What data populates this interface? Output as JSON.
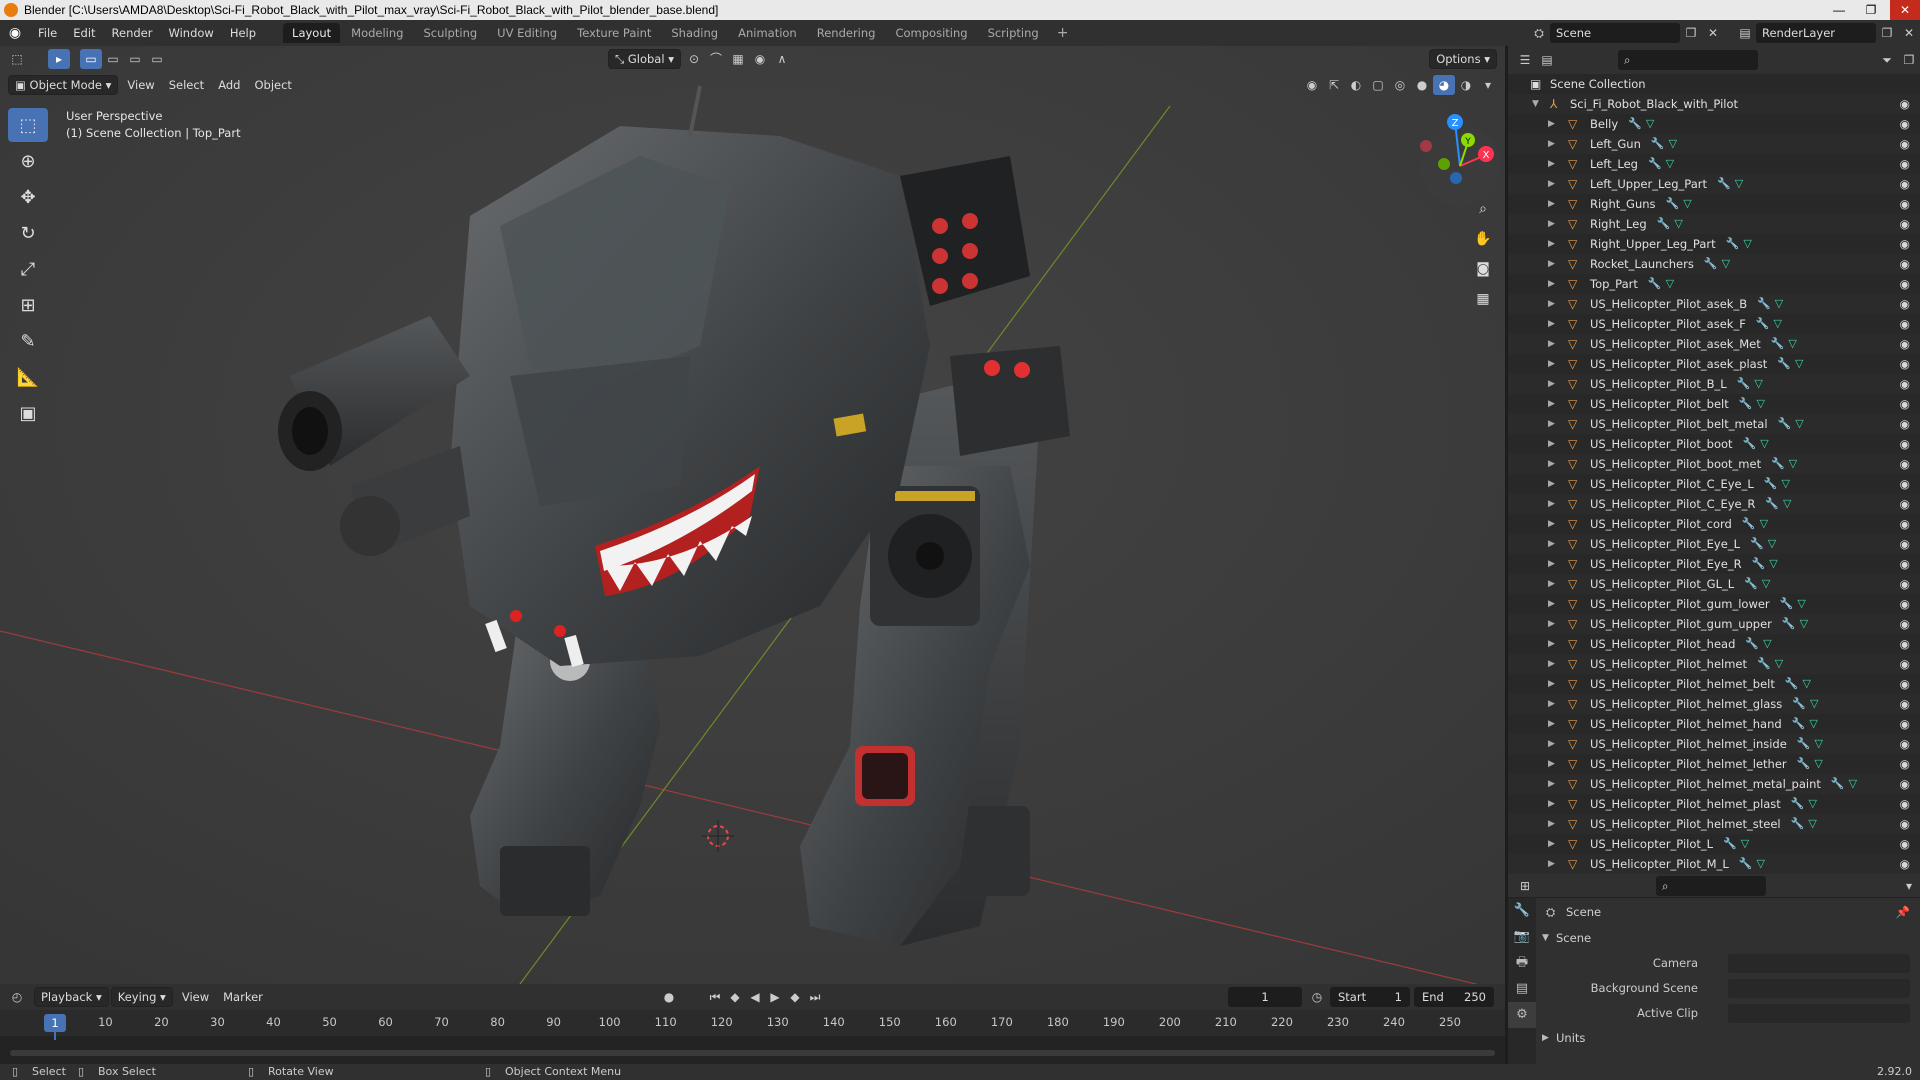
{
  "window": {
    "title": "Blender [C:\\Users\\AMDA8\\Desktop\\Sci-Fi_Robot_Black_with_Pilot_max_vray\\Sci-Fi_Robot_Black_with_Pilot_blender_base.blend]",
    "controls": [
      "—",
      "❐",
      "✕"
    ]
  },
  "menu": [
    "File",
    "Edit",
    "Render",
    "Window",
    "Help"
  ],
  "workspaces": [
    "Layout",
    "Modeling",
    "Sculpting",
    "UV Editing",
    "Texture Paint",
    "Shading",
    "Animation",
    "Rendering",
    "Compositing",
    "Scripting"
  ],
  "workspace_add": "+",
  "scene_name": "Scene",
  "render_layer": "RenderLayer",
  "viewport": {
    "mode": "Object Mode",
    "menus": [
      "View",
      "Select",
      "Add",
      "Object"
    ],
    "transform": "Global",
    "options": "Options",
    "info_line1": "User Perspective",
    "info_line2": "(1) Scene Collection | Top_Part",
    "gizmo": {
      "z": "Z",
      "y": "Y",
      "x": "X"
    },
    "colors": {
      "x_axis": "#ff3352",
      "y_axis": "#8bdc00",
      "z_axis": "#2890ff",
      "bg": "#393939"
    }
  },
  "outliner": {
    "root": "Scene Collection",
    "collection": "Sci_Fi_Robot_Black_with_Pilot",
    "items": [
      "Belly",
      "Left_Gun",
      "Left_Leg",
      "Left_Upper_Leg_Part",
      "Right_Guns",
      "Right_Leg",
      "Right_Upper_Leg_Part",
      "Rocket_Launchers",
      "Top_Part",
      "US_Helicopter_Pilot_asek_B",
      "US_Helicopter_Pilot_asek_F",
      "US_Helicopter_Pilot_asek_Met",
      "US_Helicopter_Pilot_asek_plast",
      "US_Helicopter_Pilot_B_L",
      "US_Helicopter_Pilot_belt",
      "US_Helicopter_Pilot_belt_metal",
      "US_Helicopter_Pilot_boot",
      "US_Helicopter_Pilot_boot_met",
      "US_Helicopter_Pilot_C_Eye_L",
      "US_Helicopter_Pilot_C_Eye_R",
      "US_Helicopter_Pilot_cord",
      "US_Helicopter_Pilot_Eye_L",
      "US_Helicopter_Pilot_Eye_R",
      "US_Helicopter_Pilot_GL_L",
      "US_Helicopter_Pilot_gum_lower",
      "US_Helicopter_Pilot_gum_upper",
      "US_Helicopter_Pilot_head",
      "US_Helicopter_Pilot_helmet",
      "US_Helicopter_Pilot_helmet_belt",
      "US_Helicopter_Pilot_helmet_glass",
      "US_Helicopter_Pilot_helmet_hand",
      "US_Helicopter_Pilot_helmet_inside",
      "US_Helicopter_Pilot_helmet_lether",
      "US_Helicopter_Pilot_helmet_metal_paint",
      "US_Helicopter_Pilot_helmet_plast",
      "US_Helicopter_Pilot_helmet_steel",
      "US_Helicopter_Pilot_L",
      "US_Helicopter_Pilot_M_L"
    ]
  },
  "properties": {
    "context": "Scene",
    "panel": "Scene",
    "fields": [
      {
        "label": "Camera"
      },
      {
        "label": "Background Scene"
      },
      {
        "label": "Active Clip"
      }
    ],
    "next_panel": "Units"
  },
  "timeline": {
    "menus": [
      "Playback",
      "Keying",
      "View",
      "Marker"
    ],
    "current_frame": "1",
    "start_label": "Start",
    "start": "1",
    "end_label": "End",
    "end": "250",
    "ticks": [
      "1",
      "10",
      "20",
      "30",
      "40",
      "50",
      "60",
      "70",
      "80",
      "90",
      "100",
      "110",
      "120",
      "130",
      "140",
      "150",
      "160",
      "170",
      "180",
      "190",
      "200",
      "210",
      "220",
      "230",
      "240",
      "250"
    ]
  },
  "statusbar": {
    "select": "Select",
    "box_select": "Box Select",
    "rotate_view": "Rotate View",
    "context_menu": "Object Context Menu",
    "version": "2.92.0"
  }
}
